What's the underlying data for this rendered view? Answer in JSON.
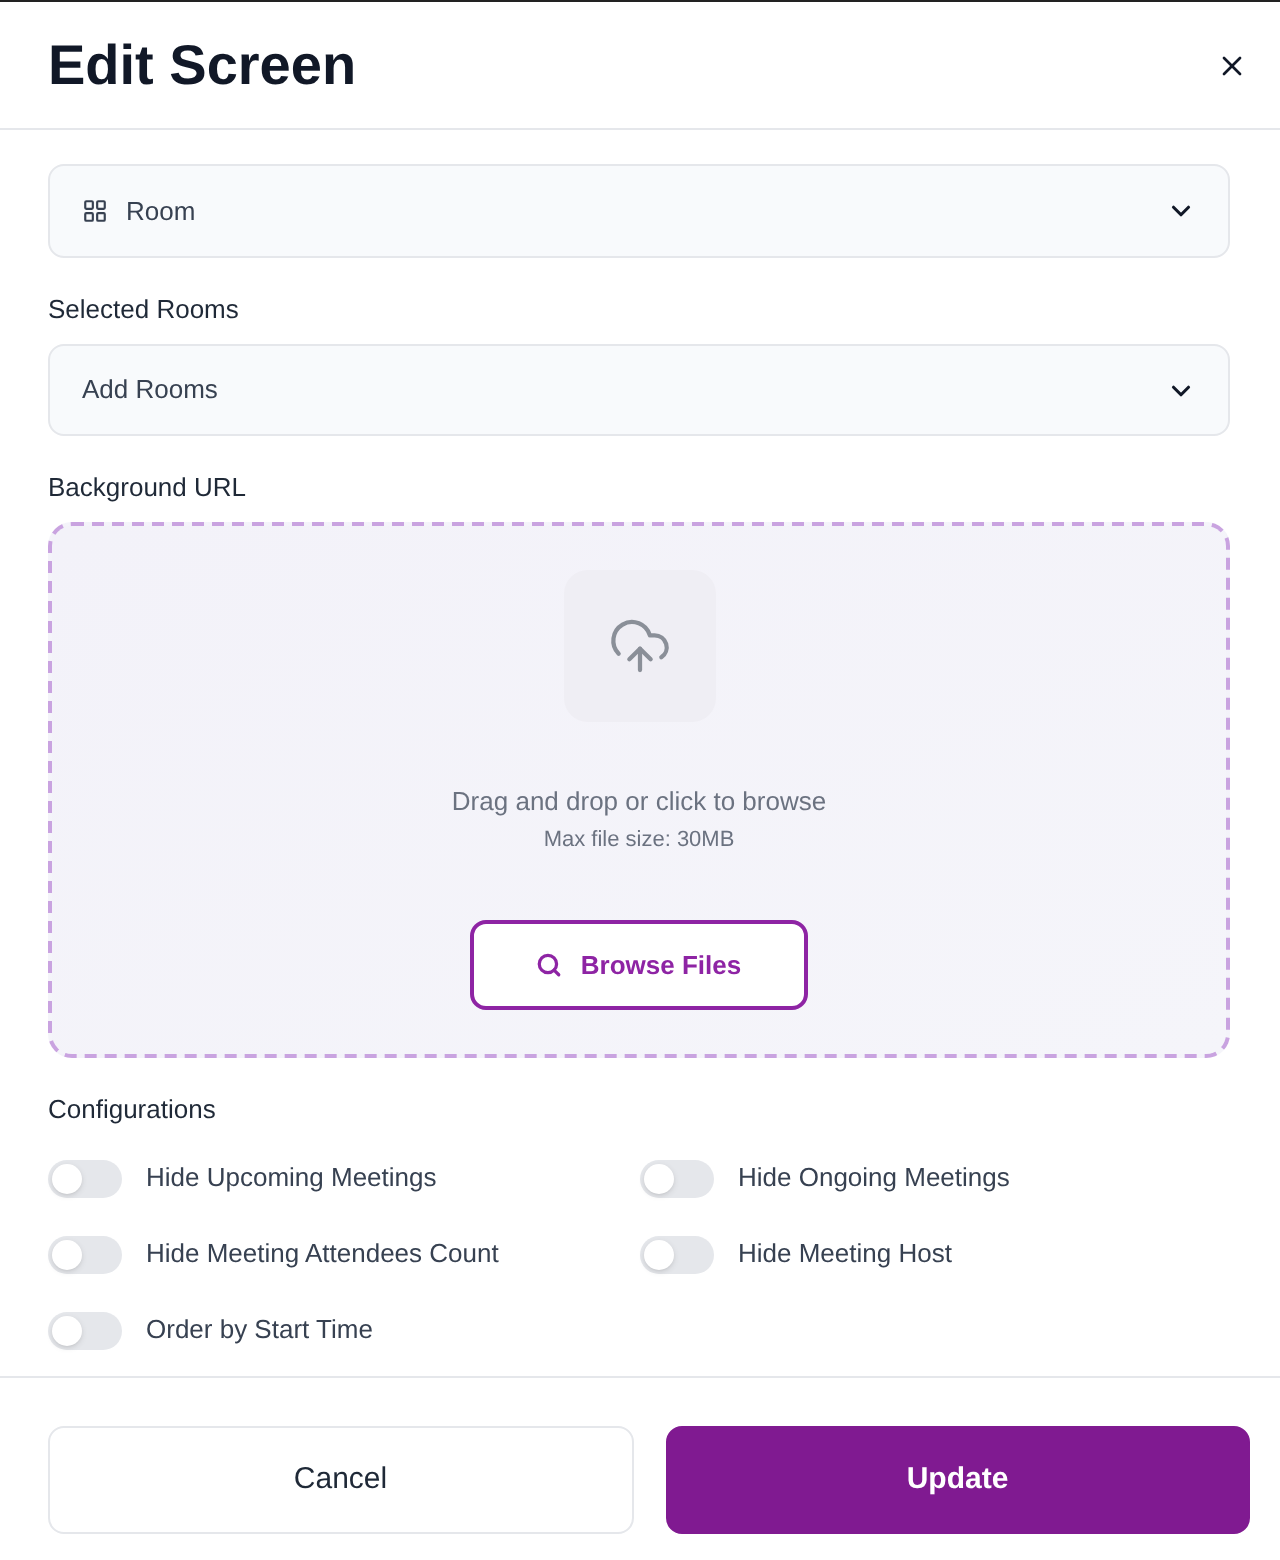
{
  "dialog": {
    "title": "Edit Screen"
  },
  "type_select": {
    "value": "Room"
  },
  "selected_rooms": {
    "label": "Selected Rooms",
    "placeholder": "Add Rooms"
  },
  "background_url": {
    "label": "Background URL",
    "hint": "Drag and drop or click to browse",
    "max_size": "Max file size: 30MB",
    "button": "Browse Files"
  },
  "configurations": {
    "label": "Configurations",
    "toggles": [
      {
        "label": "Hide Upcoming Meetings",
        "on": false
      },
      {
        "label": "Hide Ongoing Meetings",
        "on": false
      },
      {
        "label": "Hide Meeting Attendees Count",
        "on": false
      },
      {
        "label": "Hide Meeting Host",
        "on": false
      },
      {
        "label": "Order by Start Time",
        "on": false
      }
    ]
  },
  "buttons": [
    {
      "label": "Cancel",
      "kind": "secondary"
    },
    {
      "label": "Update",
      "kind": "primary"
    }
  ]
}
